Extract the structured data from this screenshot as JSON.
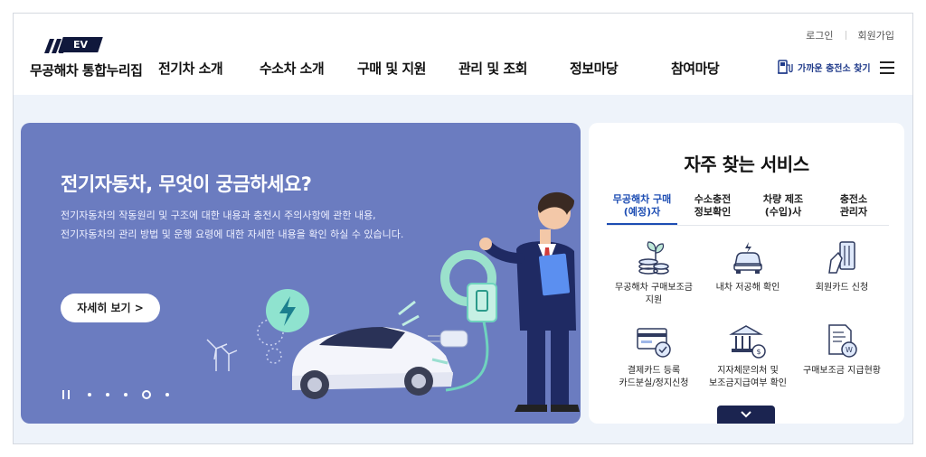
{
  "logo": {
    "badge": "EV",
    "name": "무공해차 통합누리집"
  },
  "nav": [
    {
      "label": "전기차 소개"
    },
    {
      "label": "수소차 소개"
    },
    {
      "label": "구매 및 지원"
    },
    {
      "label": "관리 및 조회"
    },
    {
      "label": "정보마당"
    },
    {
      "label": "참여마당"
    }
  ],
  "util": {
    "login": "로그인",
    "signup": "회원가입"
  },
  "find_station": "가까운 충전소 찾기",
  "hero": {
    "title": "전기자동차, 무엇이 궁금하세요?",
    "desc_line1": "전기자동차의 작동원리 및 구조에 대한 내용과 충전시 주의사항에 관한 내용,",
    "desc_line2": "전기자동차의 관리 방법 및 운행 요령에 대한 자세한 내용을 확인 하실 수 있습니다.",
    "button": "자세히 보기 >"
  },
  "services": {
    "title": "자주 찾는 서비스",
    "tabs": [
      {
        "label": "무공해차 구매\n(예정)자",
        "active": true
      },
      {
        "label": "수소충전\n정보확인",
        "active": false
      },
      {
        "label": "차량 제조\n(수입)사",
        "active": false
      },
      {
        "label": "충전소\n관리자",
        "active": false
      }
    ],
    "items": [
      {
        "label": "무공해차 구매보조금\n지원",
        "icon": "coins-leaf-icon"
      },
      {
        "label": "내차 저공해 확인",
        "icon": "car-check-icon"
      },
      {
        "label": "회원카드 신청",
        "icon": "member-card-icon"
      },
      {
        "label": "결제카드 등록\n카드분실/정지신청",
        "icon": "payment-card-icon"
      },
      {
        "label": "지자체문의처 및\n보조금지급여부 확인",
        "icon": "government-building-icon"
      },
      {
        "label": "구매보조금 지급현황",
        "icon": "document-won-icon"
      }
    ]
  },
  "colors": {
    "hero_bg": "#6b7cc0",
    "accent": "#1d4db3",
    "dark": "#1b2450"
  }
}
